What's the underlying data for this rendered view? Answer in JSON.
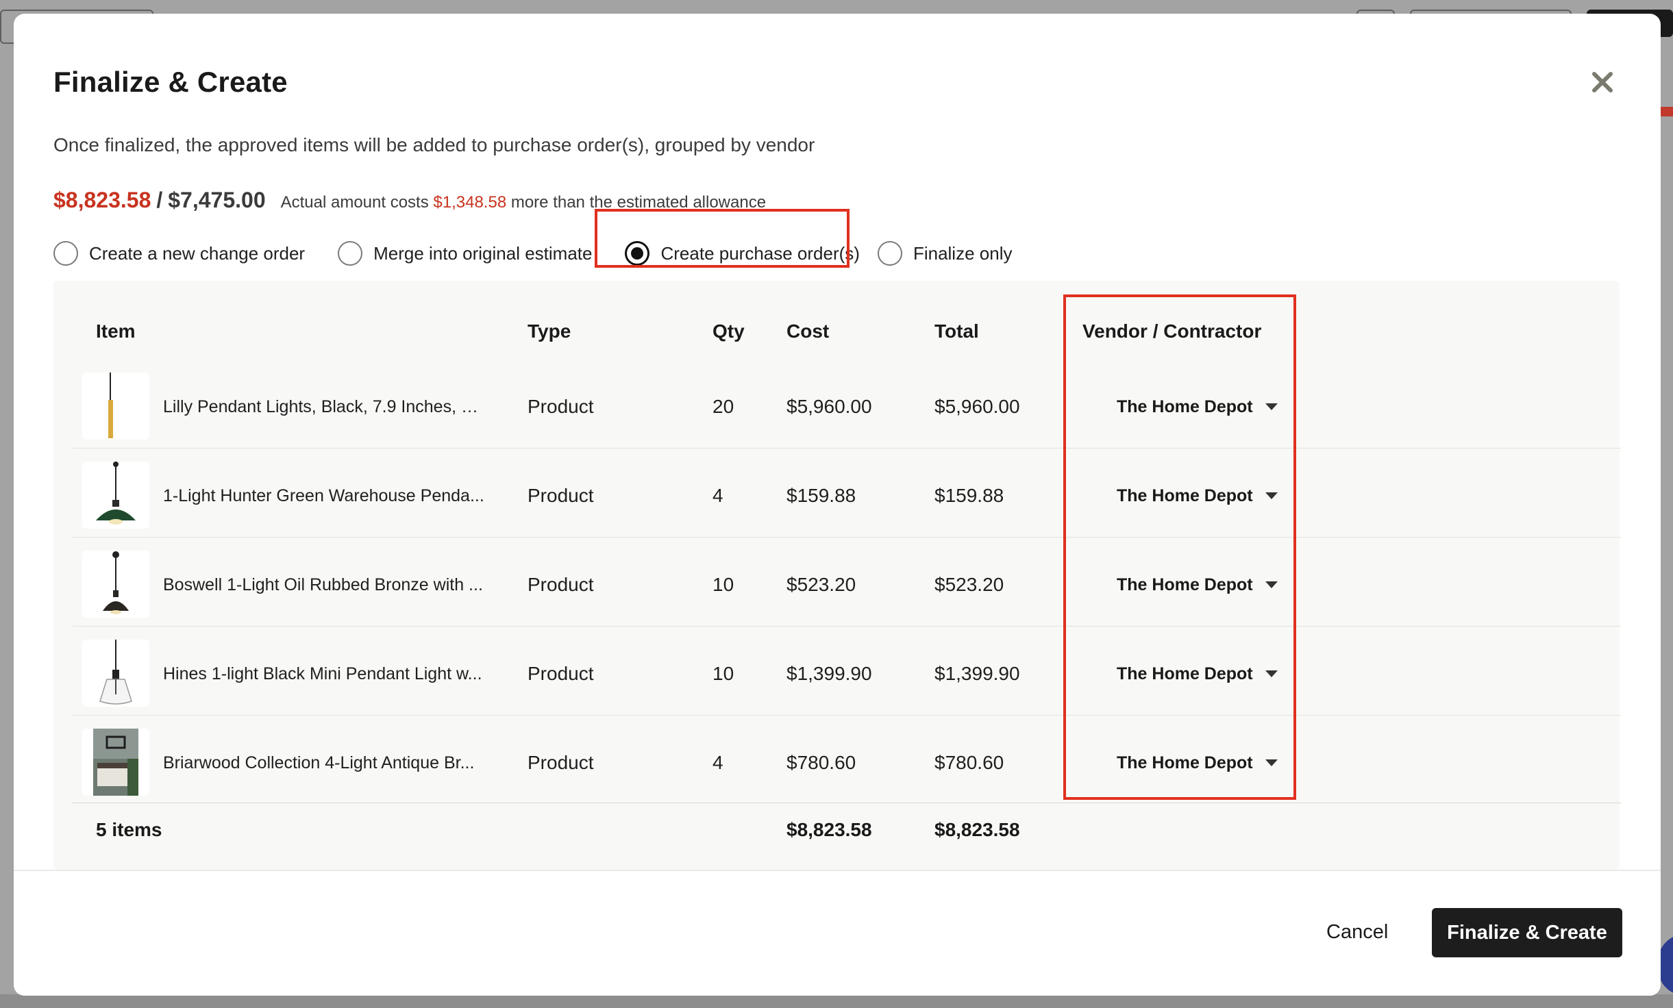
{
  "modal": {
    "title": "Finalize & Create",
    "subtitle": "Once finalized, the approved items will be added to purchase order(s), grouped by vendor"
  },
  "amounts": {
    "actual": "$8,823.58",
    "separator": "/",
    "estimated": "$7,475.00",
    "note_prefix": "Actual amount costs",
    "difference": "$1,348.58",
    "note_suffix": "more than the estimated allowance"
  },
  "options": [
    {
      "label": "Create a new change order",
      "checked": false
    },
    {
      "label": "Merge into original estimate",
      "checked": false
    },
    {
      "label": "Create purchase order(s)",
      "checked": true
    },
    {
      "label": "Finalize only",
      "checked": false
    }
  ],
  "table": {
    "headers": {
      "item": "Item",
      "type": "Type",
      "qty": "Qty",
      "cost": "Cost",
      "total": "Total",
      "vendor": "Vendor / Contractor"
    },
    "rows": [
      {
        "item": "Lilly Pendant Lights, Black, 7.9 Inches, C...",
        "type": "Product",
        "qty": "20",
        "cost": "$5,960.00",
        "total": "$5,960.00",
        "vendor": "The Home Depot",
        "thumb_icon": "pendant-light-gold-icon"
      },
      {
        "item": "1-Light Hunter Green Warehouse Penda...",
        "type": "Product",
        "qty": "4",
        "cost": "$159.88",
        "total": "$159.88",
        "vendor": "The Home Depot",
        "thumb_icon": "pendant-light-green-icon"
      },
      {
        "item": "Boswell 1-Light Oil Rubbed Bronze with ...",
        "type": "Product",
        "qty": "10",
        "cost": "$523.20",
        "total": "$523.20",
        "vendor": "The Home Depot",
        "thumb_icon": "pendant-light-bronze-icon"
      },
      {
        "item": "Hines 1-light Black Mini Pendant Light w...",
        "type": "Product",
        "qty": "10",
        "cost": "$1,399.90",
        "total": "$1,399.90",
        "vendor": "The Home Depot",
        "thumb_icon": "pendant-light-glass-icon"
      },
      {
        "item": "Briarwood Collection 4-Light Antique Br...",
        "type": "Product",
        "qty": "4",
        "cost": "$780.60",
        "total": "$780.60",
        "vendor": "The Home Depot",
        "thumb_icon": "chandelier-room-photo"
      }
    ],
    "footer": {
      "count": "5 items",
      "cost_total": "$8,823.58",
      "total_total": "$8,823.58"
    }
  },
  "buttons": {
    "cancel": "Cancel",
    "primary": "Finalize & Create"
  },
  "colors": {
    "accent_red": "#c8331f",
    "highlight_red": "#e0301e",
    "primary_button": "#1d1d1d"
  }
}
